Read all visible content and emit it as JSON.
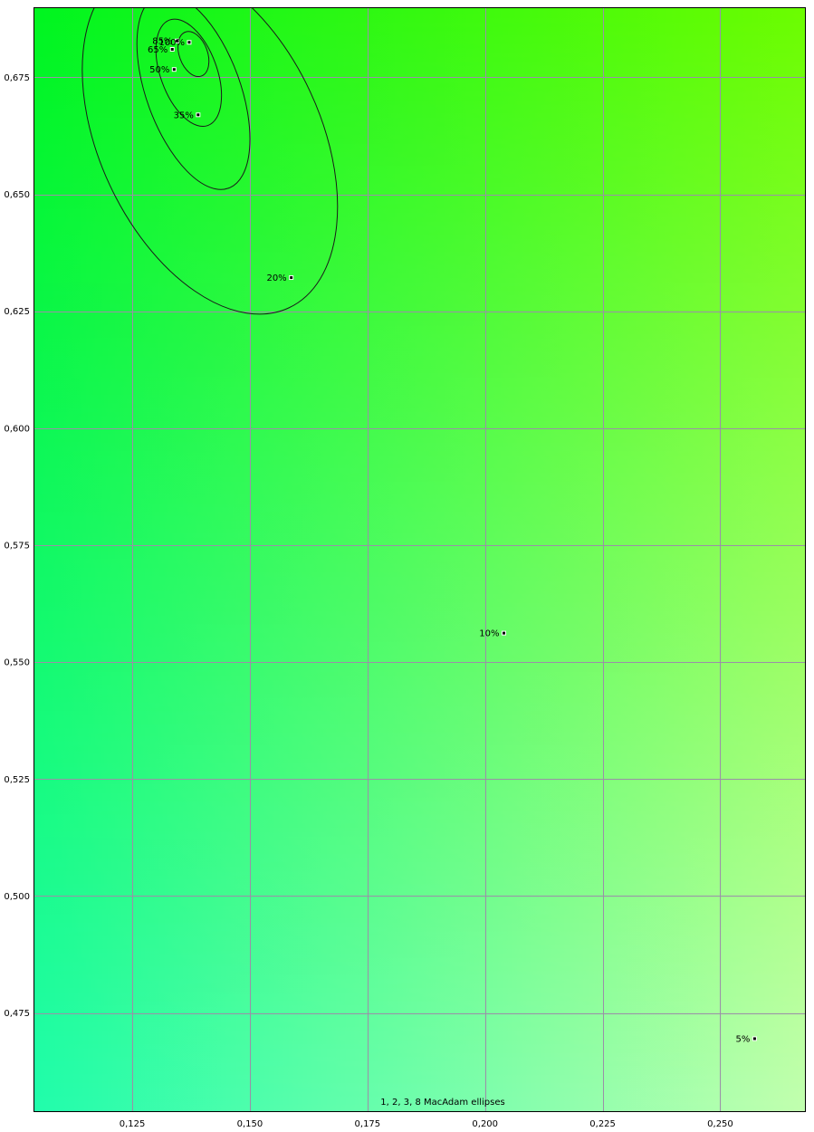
{
  "chart_data": {
    "type": "scatter",
    "title": "",
    "xlabel": "",
    "ylabel": "",
    "annotation": "1, 2, 3, 8  MacAdam ellipses",
    "xlim": [
      0.104,
      0.268
    ],
    "ylim": [
      0.454,
      0.69
    ],
    "x_ticks": [
      {
        "value": 0.125,
        "label": "0,125"
      },
      {
        "value": 0.15,
        "label": "0,150"
      },
      {
        "value": 0.175,
        "label": "0,175"
      },
      {
        "value": 0.2,
        "label": "0,200"
      },
      {
        "value": 0.225,
        "label": "0,225"
      },
      {
        "value": 0.25,
        "label": "0,250"
      }
    ],
    "y_ticks": [
      {
        "value": 0.475,
        "label": "0,475"
      },
      {
        "value": 0.5,
        "label": "0,500"
      },
      {
        "value": 0.525,
        "label": "0,525"
      },
      {
        "value": 0.55,
        "label": "0,550"
      },
      {
        "value": 0.575,
        "label": "0,575"
      },
      {
        "value": 0.6,
        "label": "0,600"
      },
      {
        "value": 0.625,
        "label": "0,625"
      },
      {
        "value": 0.65,
        "label": "0,650"
      },
      {
        "value": 0.675,
        "label": "0,675"
      }
    ],
    "grid": true,
    "points": [
      {
        "x": 0.1371,
        "y": 0.6825,
        "label": "100%"
      },
      {
        "x": 0.1345,
        "y": 0.6828,
        "label": "85%"
      },
      {
        "x": 0.1335,
        "y": 0.681,
        "label": "65%"
      },
      {
        "x": 0.1339,
        "y": 0.6767,
        "label": "50%"
      },
      {
        "x": 0.139,
        "y": 0.667,
        "label": "35%"
      },
      {
        "x": 0.1588,
        "y": 0.6322,
        "label": "20%"
      },
      {
        "x": 0.204,
        "y": 0.5562,
        "label": "10%"
      },
      {
        "x": 0.2573,
        "y": 0.4695,
        "label": "5%"
      }
    ],
    "ellipses": [
      {
        "cx": 0.138,
        "cy": 0.68,
        "rx": 0.003,
        "ry": 0.005,
        "angle": 20
      },
      {
        "cx": 0.137,
        "cy": 0.676,
        "rx": 0.006,
        "ry": 0.012,
        "angle": 20
      },
      {
        "cx": 0.138,
        "cy": 0.672,
        "rx": 0.01,
        "ry": 0.022,
        "angle": 20
      },
      {
        "cx": 0.1415,
        "cy": 0.662,
        "rx": 0.0235,
        "ry": 0.04,
        "angle": 25
      }
    ],
    "background_colors": {
      "top_left": "#00f520",
      "top_right": "#6cfd00",
      "bottom_left": "#20fdac",
      "bottom_right": "#c2ffaf"
    },
    "grid_color": "#9b8fa8",
    "border_color": "#000000"
  }
}
